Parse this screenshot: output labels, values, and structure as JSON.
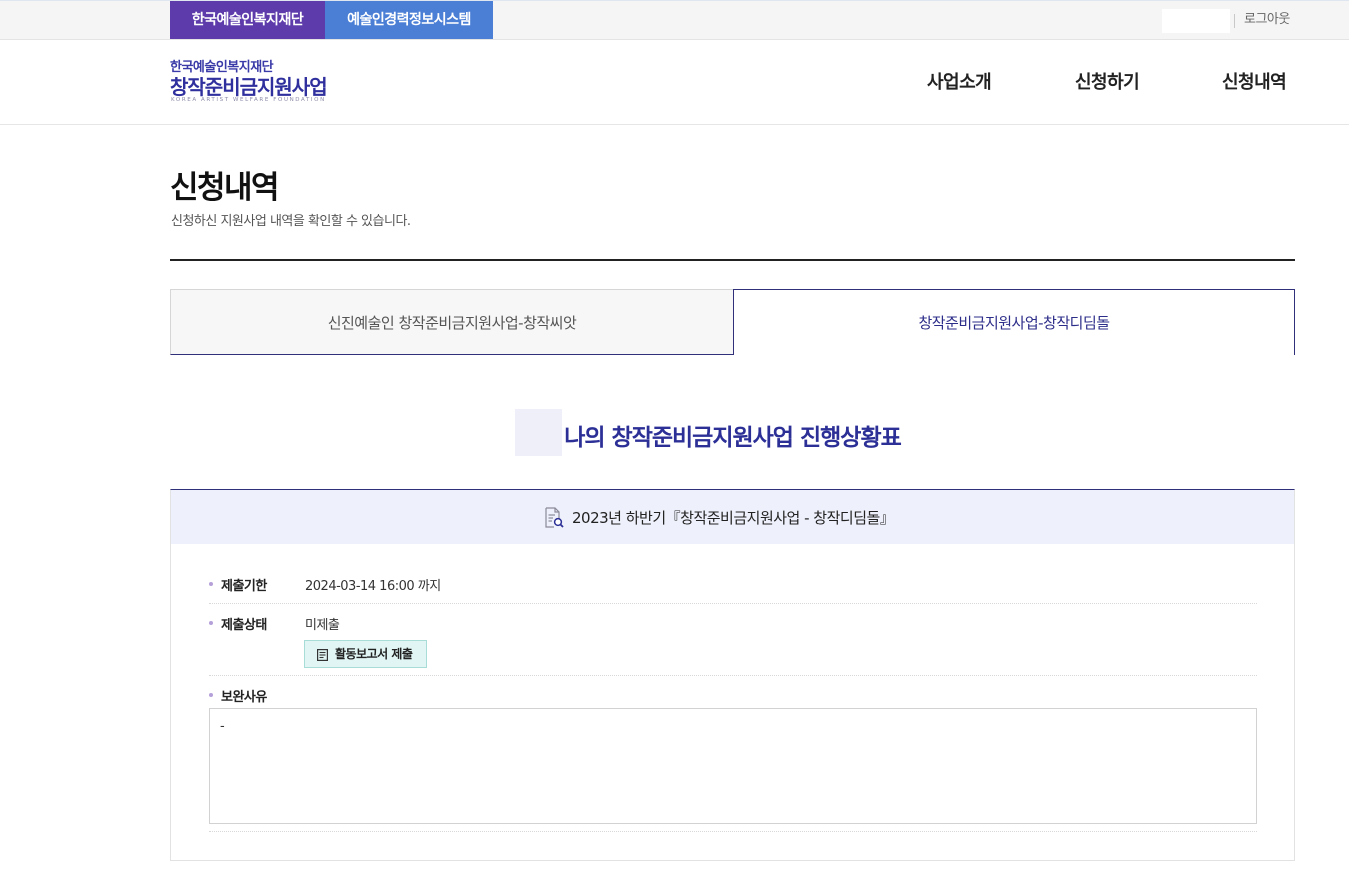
{
  "topbar": {
    "site_tabs": [
      {
        "label": "한국예술인복지재단",
        "color": "#5d3bab"
      },
      {
        "label": "예술인경력정보시스템",
        "color": "#4b7fd6"
      }
    ],
    "logout_label": "로그아웃"
  },
  "header": {
    "logo": {
      "org_name": "한국예술인복지재단",
      "program_name": "창작준비금지원사업",
      "english_name": "KOREA ARTIST WELFARE FOUNDATION"
    },
    "nav": [
      "사업소개",
      "신청하기",
      "신청내역"
    ]
  },
  "page": {
    "title": "신청내역",
    "description": "신청하신 지원사업 내역을 확인할 수 있습니다."
  },
  "tabs": [
    {
      "label": "신진예술인 창작준비금지원사업-창작씨앗",
      "active": false
    },
    {
      "label": "창작준비금지원사업-창작디딤돌",
      "active": true
    }
  ],
  "section": {
    "title": "나의 창작준비금지원사업 진행상황표"
  },
  "card": {
    "heading": "2023년 하반기『창작준비금지원사업 - 창작디딤돌』",
    "heading_icon": "document-search-icon",
    "rows": {
      "deadline": {
        "label": "제출기한",
        "value": "2024-03-14 16:00 까지"
      },
      "status": {
        "label": "제출상태",
        "value": "미제출",
        "button_label": "활동보고서 제출",
        "button_icon": "document-icon"
      },
      "reason": {
        "label": "보완사유",
        "value": "-"
      }
    }
  },
  "colors": {
    "brand_navy": "#2b2f96",
    "purple": "#5d3bab",
    "blue": "#4b7fd6",
    "card_head_bg": "#eef0fb",
    "button_bg": "#e1f6f4"
  }
}
